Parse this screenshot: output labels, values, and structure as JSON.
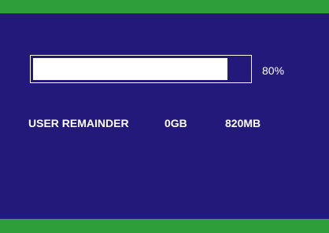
{
  "colors": {
    "background": "#22197a",
    "accent_bar": "#2e9e3a",
    "foreground": "#ffffff"
  },
  "progress": {
    "fraction": 0.9,
    "label": "80%"
  },
  "storage": {
    "label": "USER REMAINDER",
    "gb_value": "0GB",
    "mb_value": "820MB"
  }
}
